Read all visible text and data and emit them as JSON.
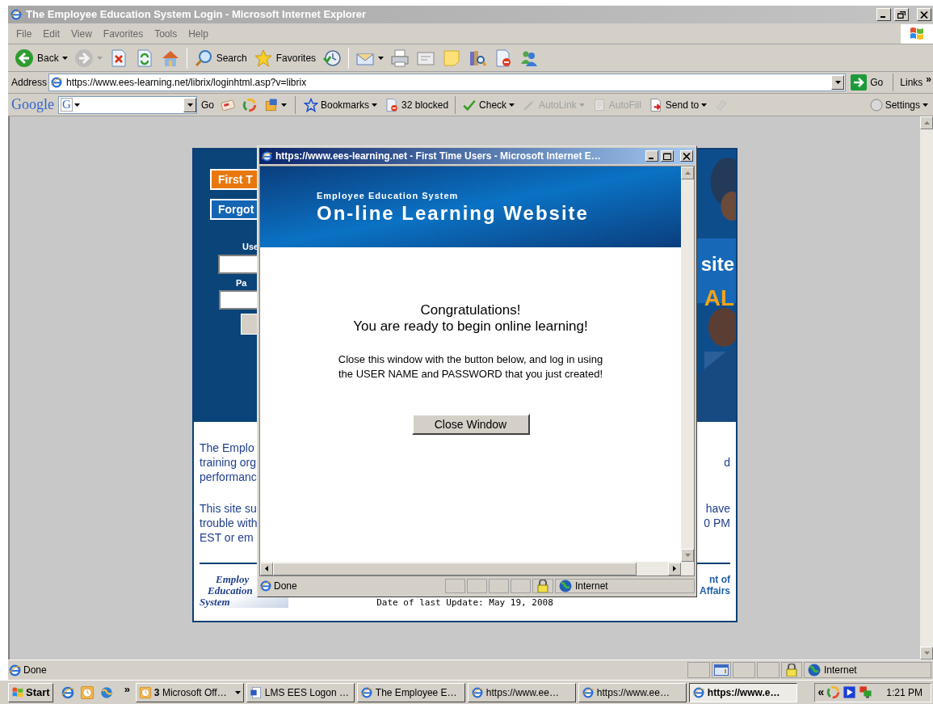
{
  "browser": {
    "title": "The Employee Education System Login - Microsoft Internet Explorer",
    "menu": [
      "File",
      "Edit",
      "View",
      "Favorites",
      "Tools",
      "Help"
    ],
    "toolbar": [
      [
        {
          "kind": "back",
          "label": "Back",
          "dropdown": true
        },
        {
          "kind": "forward",
          "dropdown": true
        },
        {
          "kind": "stop"
        },
        {
          "kind": "refresh"
        },
        {
          "kind": "home"
        }
      ],
      [
        {
          "kind": "search",
          "label": "Search"
        },
        {
          "kind": "favorites",
          "label": "Favorites"
        },
        {
          "kind": "history"
        }
      ],
      [
        {
          "kind": "mail",
          "dropdown": true
        },
        {
          "kind": "print"
        },
        {
          "kind": "edit"
        },
        {
          "kind": "note"
        },
        {
          "kind": "research"
        },
        {
          "kind": "blocked"
        },
        {
          "kind": "messenger"
        }
      ]
    ],
    "address": {
      "label": "Address",
      "url": "https://www.ees-learning.net/librix/loginhtml.asp?v=librix",
      "go": "Go",
      "links": "Links",
      "more": "»"
    },
    "google": {
      "logo": "Google",
      "engine": "G",
      "go": "Go",
      "settings": "Settings",
      "items": [
        {
          "kind": "news"
        },
        {
          "kind": "picasa"
        },
        {
          "kind": "popup",
          "dropdown": true
        },
        {
          "kind": "bookmarks",
          "label": "Bookmarks",
          "dropdown": true,
          "disabled": false
        },
        {
          "kind": "blocked",
          "label": "32 blocked",
          "disabled": false
        },
        {
          "kind": "check",
          "label": "Check",
          "dropdown": true,
          "disabled": false
        },
        {
          "kind": "autolink",
          "label": "AutoLink",
          "dropdown": true,
          "disabled": true
        },
        {
          "kind": "autofill",
          "label": "AutoFill",
          "disabled": true
        },
        {
          "kind": "sendto",
          "label": "Send to",
          "dropdown": true,
          "disabled": false
        },
        {
          "kind": "eraser",
          "disabled": true
        }
      ]
    },
    "status": {
      "text": "Done",
      "zone": "Internet",
      "secure": true,
      "popup_blocked": true
    }
  },
  "page": {
    "buttons": [
      {
        "label": "First T",
        "kind": "orange"
      },
      {
        "label": "Forgot",
        "kind": "blue"
      }
    ],
    "username_label": "Use",
    "password_label": "Pa",
    "banner_fragments": [
      "site",
      "AL"
    ],
    "paragraphs": [
      [
        {
          "left": "The Emplo"
        },
        {
          "left": "training org",
          "right": "d"
        },
        {
          "left": "performanc"
        }
      ],
      [
        {
          "left": "This site su",
          "right": "have"
        },
        {
          "left": "trouble with",
          "right": "0 PM"
        },
        {
          "left": "EST or em"
        }
      ]
    ],
    "logo": [
      "Employ",
      "Education",
      "System"
    ],
    "agency": [
      "nt of",
      "Affairs"
    ],
    "updated": "Date of last Update: May 19, 2008"
  },
  "popup": {
    "title": "https://www.ees-learning.net - First Time Users - Microsoft Internet E…",
    "banner_subtitle": "Employee Education System",
    "banner_title": "On-line Learning Website",
    "heading": [
      "Congratulations!",
      "You are ready to begin online learning!"
    ],
    "message": [
      "Close this window with the button below, and log in using",
      "the USER NAME and PASSWORD that you just created!"
    ],
    "button": "Close Window",
    "status": "Done",
    "zone": "Internet",
    "secure": true
  },
  "taskbar": {
    "start": "Start",
    "quick_launch": [
      {
        "kind": "ie"
      },
      {
        "kind": "clock"
      },
      {
        "kind": "globe"
      }
    ],
    "more": "»",
    "tasks": [
      {
        "label": "**3** Microsoft Off…",
        "kind": "clock",
        "group": true,
        "selected": false
      },
      {
        "label": "LMS EES Logon …",
        "kind": "word",
        "group": false,
        "selected": false
      },
      {
        "label": "The Employee E…",
        "kind": "ie",
        "group": false,
        "selected": false
      },
      {
        "label": "https://www.ee…",
        "kind": "ie",
        "group": false,
        "selected": false
      },
      {
        "label": "https://www.ee…",
        "kind": "ie",
        "group": false,
        "selected": false
      },
      {
        "label": "https://www.e…",
        "kind": "ie",
        "group": false,
        "selected": true
      }
    ],
    "expand": "«",
    "tray": [
      {
        "kind": "picasa"
      },
      {
        "kind": "media"
      },
      {
        "kind": "network"
      }
    ],
    "clock": "1:21 PM"
  }
}
